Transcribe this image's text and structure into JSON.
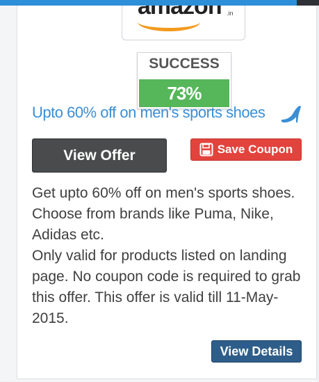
{
  "logo": {
    "brand": "amazon",
    "suffix": ".in"
  },
  "success": {
    "label": "SUCCESS",
    "rate": "73%"
  },
  "offer": {
    "title": "Upto 60% off on men's sports shoes",
    "icon": "high-heel-icon",
    "view_offer_label": "View Offer",
    "save_coupon_label": "Save Coupon",
    "description_lines": [
      "Get upto 60% off on men's sports shoes. Choose from brands like Puma, Nike, Adidas etc.",
      "Only valid for products listed on landing page. No coupon code is required to grab this offer. This offer is valid till 11-May-2015."
    ],
    "view_details_label": "View Details"
  },
  "colors": {
    "accent_blue": "#3a8fd6",
    "success_green": "#55b65a",
    "save_red": "#e2443d",
    "details_blue": "#2e5d8a",
    "offer_button": "#4a4b4c"
  }
}
